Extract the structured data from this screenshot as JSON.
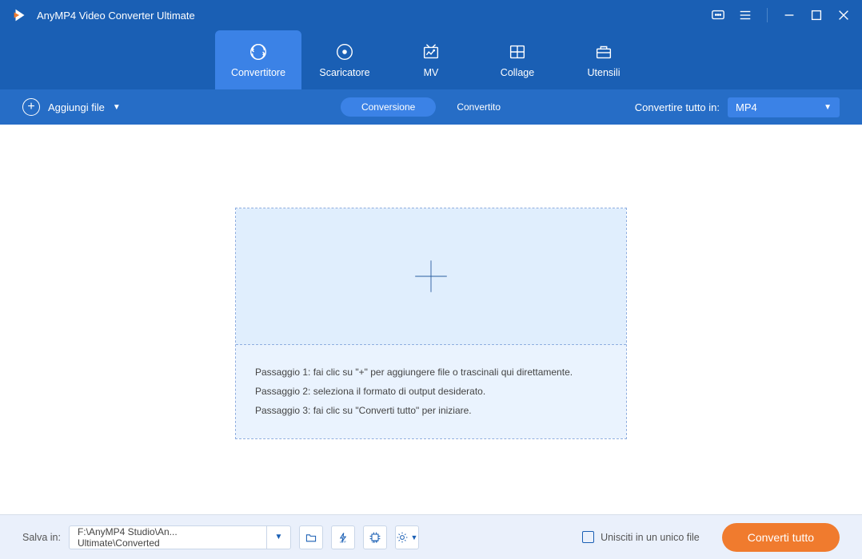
{
  "app_title": "AnyMP4 Video Converter Ultimate",
  "nav": {
    "items": [
      {
        "label": "Convertitore"
      },
      {
        "label": "Scaricatore"
      },
      {
        "label": "MV"
      },
      {
        "label": "Collage"
      },
      {
        "label": "Utensili"
      }
    ]
  },
  "toolbar": {
    "add_file": "Aggiungi file",
    "seg_convert": "Conversione",
    "seg_converted": "Convertito",
    "convert_all_label": "Convertire tutto in:",
    "format_selected": "MP4"
  },
  "dropzone": {
    "step1": "Passaggio 1: fai clic su \"+\" per aggiungere file o trascinali qui direttamente.",
    "step2": "Passaggio 2: seleziona il formato di output desiderato.",
    "step3": "Passaggio 3: fai clic su \"Converti tutto\" per iniziare."
  },
  "bottom": {
    "save_label": "Salva in:",
    "path": "F:\\AnyMP4 Studio\\An... Ultimate\\Converted",
    "merge_label": "Unisciti in un unico file",
    "convert_button": "Converti tutto"
  }
}
